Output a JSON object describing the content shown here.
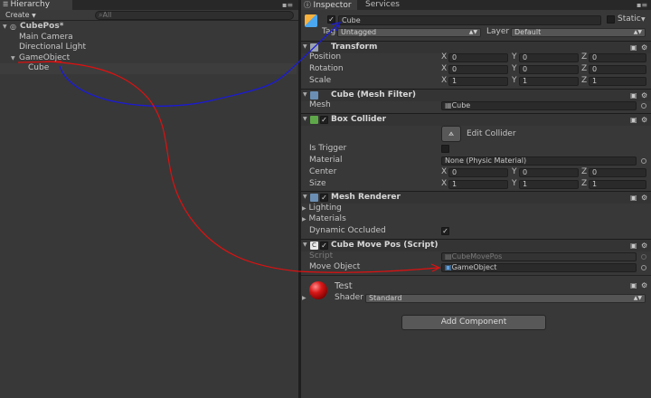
{
  "hierarchy": {
    "tab_label": "Hierarchy",
    "create_label": "Create",
    "search_placeholder": "All",
    "scene_name": "CubePos*",
    "items": [
      "Main Camera",
      "Directional Light",
      "GameObject",
      "Cube"
    ]
  },
  "inspector": {
    "tabs": [
      "Inspector",
      "Services"
    ],
    "object_name": "Cube",
    "static_label": "Static",
    "tag_label": "Tag",
    "tag_value": "Untagged",
    "layer_label": "Layer",
    "layer_value": "Default",
    "transform": {
      "title": "Transform",
      "rows": [
        {
          "label": "Position",
          "x": "0",
          "y": "0",
          "z": "0"
        },
        {
          "label": "Rotation",
          "x": "0",
          "y": "0",
          "z": "0"
        },
        {
          "label": "Scale",
          "x": "1",
          "y": "1",
          "z": "1"
        }
      ],
      "axes": [
        "X",
        "Y",
        "Z"
      ]
    },
    "mesh_filter": {
      "title": "Cube (Mesh Filter)",
      "mesh_label": "Mesh",
      "mesh_value": "Cube"
    },
    "box_collider": {
      "title": "Box Collider",
      "edit_label": "Edit Collider",
      "is_trigger_label": "Is Trigger",
      "material_label": "Material",
      "material_value": "None (Physic Material)",
      "center_label": "Center",
      "center": {
        "x": "0",
        "y": "0",
        "z": "0"
      },
      "size_label": "Size",
      "size": {
        "x": "1",
        "y": "1",
        "z": "1"
      }
    },
    "mesh_renderer": {
      "title": "Mesh Renderer",
      "lighting_label": "Lighting",
      "materials_label": "Materials",
      "dynamic_occluded_label": "Dynamic Occluded"
    },
    "script_component": {
      "title": "Cube Move Pos (Script)",
      "script_label": "Script",
      "script_value": "CubeMovePos",
      "move_object_label": "Move Object",
      "move_object_value": "GameObject"
    },
    "material": {
      "name": "Test",
      "shader_label": "Shader",
      "shader_value": "Standard"
    },
    "add_component_label": "Add Component"
  },
  "colors": {
    "annotation_blue": "#1a1ad6",
    "annotation_red": "#e01010",
    "background": "#383838"
  }
}
